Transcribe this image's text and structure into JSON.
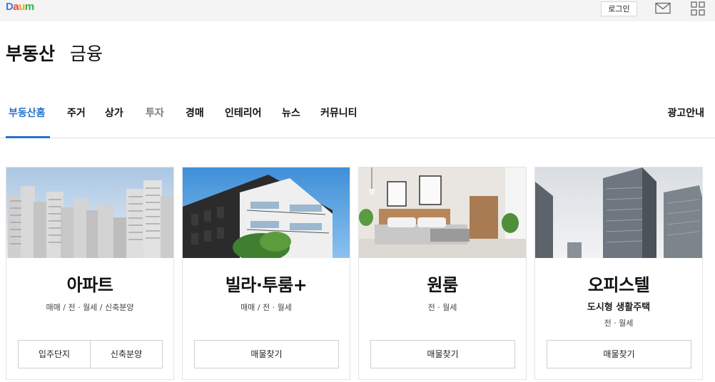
{
  "topbar": {
    "logo": {
      "d": "D",
      "a": "a",
      "u": "u",
      "m": "m"
    },
    "login_label": "로그인"
  },
  "section_tabs": [
    {
      "label": "부동산",
      "active": true
    },
    {
      "label": "금융",
      "active": false
    }
  ],
  "nav": {
    "items": [
      {
        "label": "부동산홈",
        "state": "active"
      },
      {
        "label": "주거",
        "state": "normal"
      },
      {
        "label": "상가",
        "state": "normal"
      },
      {
        "label": "투자",
        "state": "muted"
      },
      {
        "label": "경매",
        "state": "normal"
      },
      {
        "label": "인테리어",
        "state": "normal"
      },
      {
        "label": "뉴스",
        "state": "normal"
      },
      {
        "label": "커뮤니티",
        "state": "normal"
      }
    ],
    "ad_label": "광고안내"
  },
  "cards": [
    {
      "title": "아파트",
      "types": "매매 / 전 · 월세 / 신축분양",
      "buttons": [
        "입주단지",
        "신축분양"
      ]
    },
    {
      "title": "빌라·투룸+",
      "types": "매매 / 전 · 월세",
      "buttons": [
        "매물찾기"
      ]
    },
    {
      "title": "원룸",
      "types": "전 · 월세",
      "buttons": [
        "매물찾기"
      ]
    },
    {
      "title": "오피스텔",
      "subtitle": "도시형 생활주택",
      "types": "전 · 월세",
      "buttons": [
        "매물찾기"
      ]
    }
  ],
  "colors": {
    "accent": "#2573c9",
    "muted": "#7d7d7d",
    "topbar_bg": "#f4f4f4"
  },
  "icons": [
    "mail-icon",
    "apps-grid-icon"
  ]
}
